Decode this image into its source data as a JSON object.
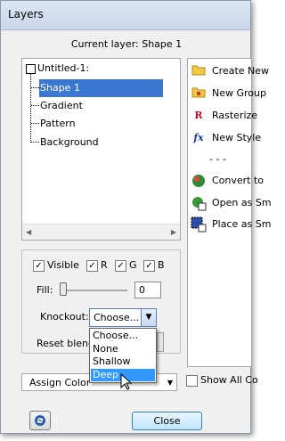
{
  "window": {
    "title": "Layers"
  },
  "current_layer": {
    "label": "Current layer: Shape 1"
  },
  "tree": {
    "items": [
      {
        "label": "Untitled-1:"
      },
      {
        "label": "Shape 1"
      },
      {
        "label": "Gradient"
      },
      {
        "label": "Pattern"
      },
      {
        "label": "Background"
      }
    ]
  },
  "actions": {
    "items": [
      {
        "label": "Create New",
        "icon": "folder-icon"
      },
      {
        "label": "New Group",
        "icon": "folder-group-icon"
      },
      {
        "label": "Rasterize",
        "icon": "rasterize-icon"
      },
      {
        "label": "New Style",
        "icon": "fx-icon"
      },
      {
        "label": "- - -",
        "icon": ""
      },
      {
        "label": "Convert to",
        "icon": "convert-icon"
      },
      {
        "label": "Open as Sm",
        "icon": "open-smart-icon"
      },
      {
        "label": "Place as Sm",
        "icon": "place-smart-icon"
      }
    ]
  },
  "options": {
    "visible": "Visible",
    "r": "R",
    "g": "G",
    "b": "B",
    "fill_label": "Fill:",
    "fill_value": "0",
    "knockout_label": "Knockout:",
    "knockout_value": "Choose...",
    "knockout_options": [
      "Choose...",
      "None",
      "Shallow",
      "Deep"
    ],
    "reset_label": "Reset blending"
  },
  "assign": {
    "value": "Assign Color"
  },
  "show_all": {
    "label": "Show All Co"
  },
  "footer": {
    "close_label": "Close"
  }
}
